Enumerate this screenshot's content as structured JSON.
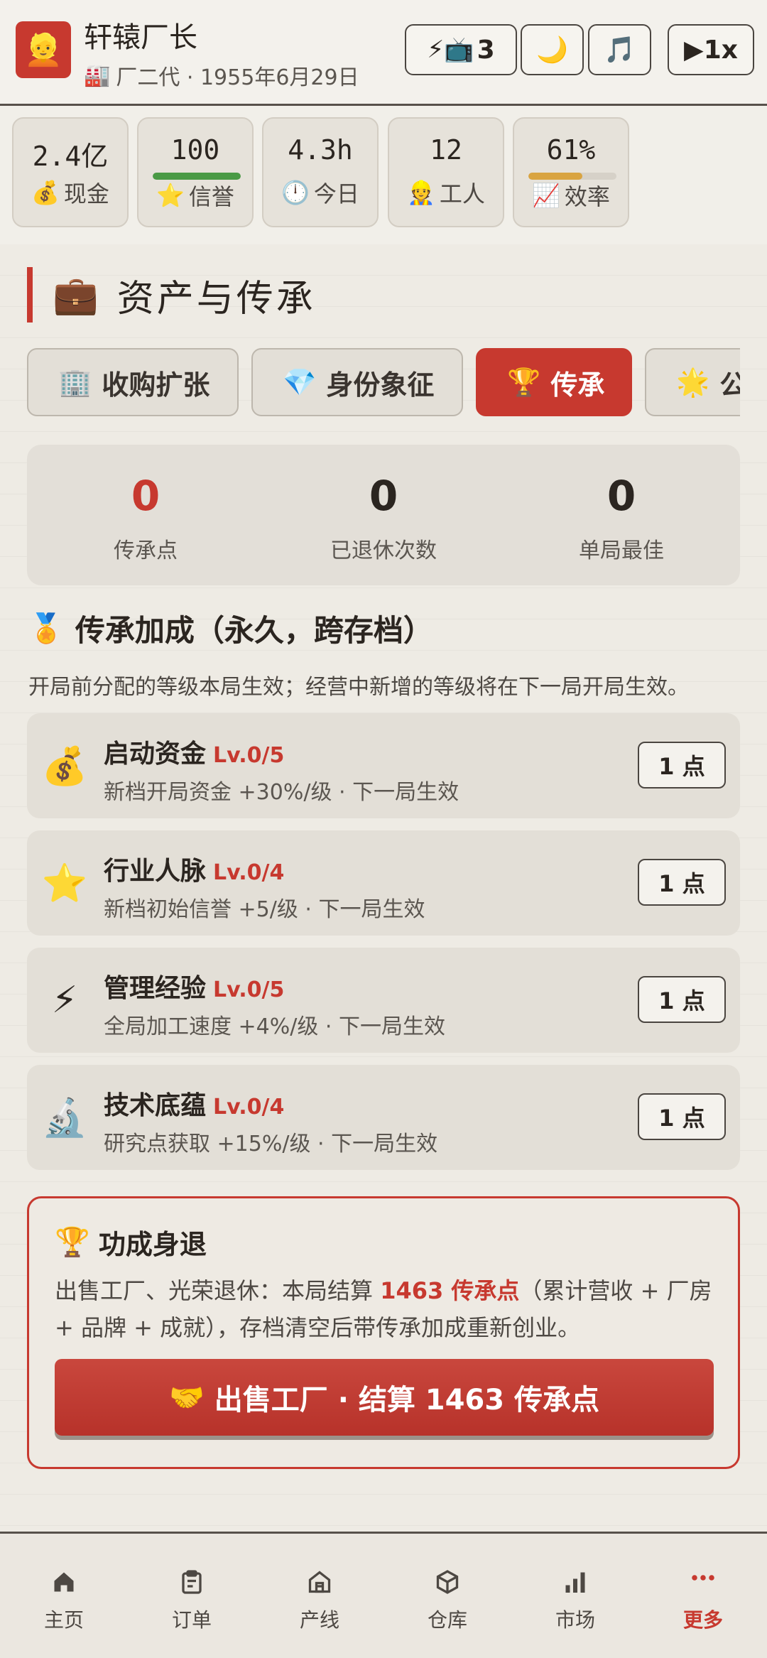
{
  "header": {
    "avatar_emoji": "👱",
    "name": "轩辕厂长",
    "sub_icon": "🏭",
    "subtitle": "厂二代 · 1955年6月29日",
    "energy_icons": "⚡📺",
    "energy_count": "3",
    "night_icon": "🌙",
    "music_icon": "🎵",
    "speed_label": "▶1x"
  },
  "stats": [
    {
      "value": "2.4亿",
      "icon": "💰",
      "label": "现金"
    },
    {
      "value": "100",
      "icon": "⭐",
      "label": "信誉",
      "progress": 1.0,
      "color": "#4a9a45"
    },
    {
      "value": "4.3h",
      "icon": "🕛",
      "label": "今日"
    },
    {
      "value": "12",
      "icon": "👷",
      "label": "工人"
    },
    {
      "value": "61%",
      "icon": "📈",
      "label": "效率",
      "progress": 0.61,
      "color": "#d9a441"
    }
  ],
  "section": {
    "icon": "💼",
    "title": "资产与传承"
  },
  "tabs": [
    {
      "icon": "🏢",
      "label": "收购扩张"
    },
    {
      "icon": "💎",
      "label": "身份象征"
    },
    {
      "icon": "🏆",
      "label": "传承"
    },
    {
      "icon": "🌟",
      "label": "公"
    }
  ],
  "counters": [
    {
      "value": "0",
      "label": "传承点"
    },
    {
      "value": "0",
      "label": "已退休次数"
    },
    {
      "value": "0",
      "label": "单局最佳"
    }
  ],
  "legacy": {
    "icon": "🏅",
    "title": "传承加成（永久，跨存档）",
    "desc": "开局前分配的等级本局生效；经营中新增的等级将在下一局开局生效。"
  },
  "upgrades": [
    {
      "icon": "💰",
      "name": "启动资金",
      "level": "Lv.0/5",
      "desc": "新档开局资金 +30%/级 · 下一局生效",
      "cost": "1 点"
    },
    {
      "icon": "⭐",
      "name": "行业人脉",
      "level": "Lv.0/4",
      "desc": "新档初始信誉 +5/级 · 下一局生效",
      "cost": "1 点"
    },
    {
      "icon": "⚡",
      "name": "管理经验",
      "level": "Lv.0/5",
      "desc": "全局加工速度 +4%/级 · 下一局生效",
      "cost": "1 点"
    },
    {
      "icon": "🔬",
      "name": "技术底蕴",
      "level": "Lv.0/4",
      "desc": "研究点获取 +15%/级 · 下一局生效",
      "cost": "1 点"
    }
  ],
  "retire": {
    "icon": "🏆",
    "title": "功成身退",
    "text_before": "出售工厂、光荣退休：本局结算 ",
    "text_highlight": "1463 传承点",
    "text_after": "（累计营收 + 厂房 + 品牌 + 成就），存档清空后带传承加成重新创业。",
    "button_icon": "🤝",
    "button_label": "出售工厂 · 结算 1463 传承点"
  },
  "nav": [
    {
      "label": "主页",
      "icon": "home-icon"
    },
    {
      "label": "订单",
      "icon": "clipboard-icon"
    },
    {
      "label": "产线",
      "icon": "factory-icon"
    },
    {
      "label": "仓库",
      "icon": "box-icon"
    },
    {
      "label": "市场",
      "icon": "bar-chart-icon"
    },
    {
      "label": "更多",
      "icon": "more-dots-icon"
    }
  ],
  "colors": {
    "accent": "#c7392f",
    "text": "#2b2520",
    "muted": "#5b5650"
  }
}
